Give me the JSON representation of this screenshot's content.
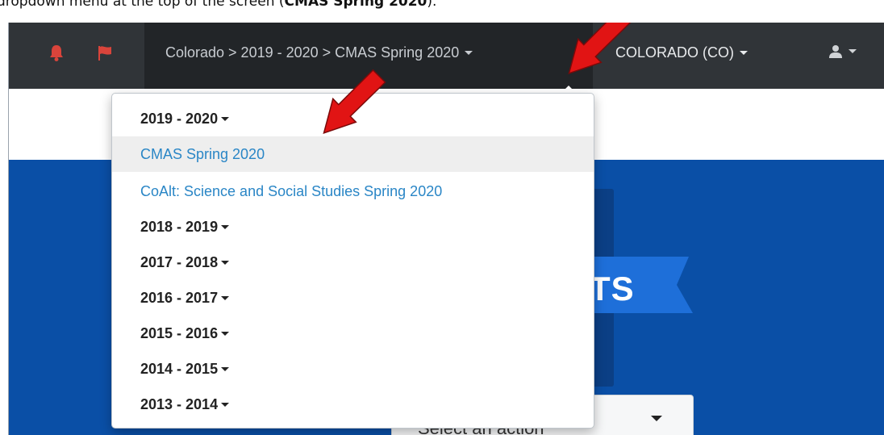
{
  "caption": {
    "prefix": "dropdown menu at the top of the screen (",
    "bold": "CMAS Spring 2020",
    "suffix": ")."
  },
  "header": {
    "breadcrumb": "Colorado > 2019 - 2020 > CMAS Spring 2020",
    "state_label": "COLORADO (CO)"
  },
  "icons": {
    "bell": "bell-icon",
    "flag": "flag-icon",
    "user": "user-icon",
    "arrow": "red-arrow-icon"
  },
  "dropdown": {
    "items": [
      {
        "label": "2019 - 2020",
        "kind": "year"
      },
      {
        "label": "CMAS Spring 2020",
        "kind": "assessment",
        "selected": true
      },
      {
        "label": "CoAlt: Science and Social Studies Spring 2020",
        "kind": "assessment"
      },
      {
        "label": "2018 - 2019",
        "kind": "year"
      },
      {
        "label": "2017 - 2018",
        "kind": "year"
      },
      {
        "label": "2016 - 2017",
        "kind": "year"
      },
      {
        "label": "2015 - 2016",
        "kind": "year"
      },
      {
        "label": "2014 - 2015",
        "kind": "year"
      },
      {
        "label": "2013 - 2014",
        "kind": "year"
      }
    ]
  },
  "background": {
    "ribbon_text": "TS",
    "action_placeholder": "Select an action"
  },
  "colors": {
    "navbar": "#303438",
    "nav_dark": "#222528",
    "blue": "#0a4fa6",
    "link": "#2a86c6",
    "arrow": "#e11414",
    "icon_red": "#d9443b"
  }
}
